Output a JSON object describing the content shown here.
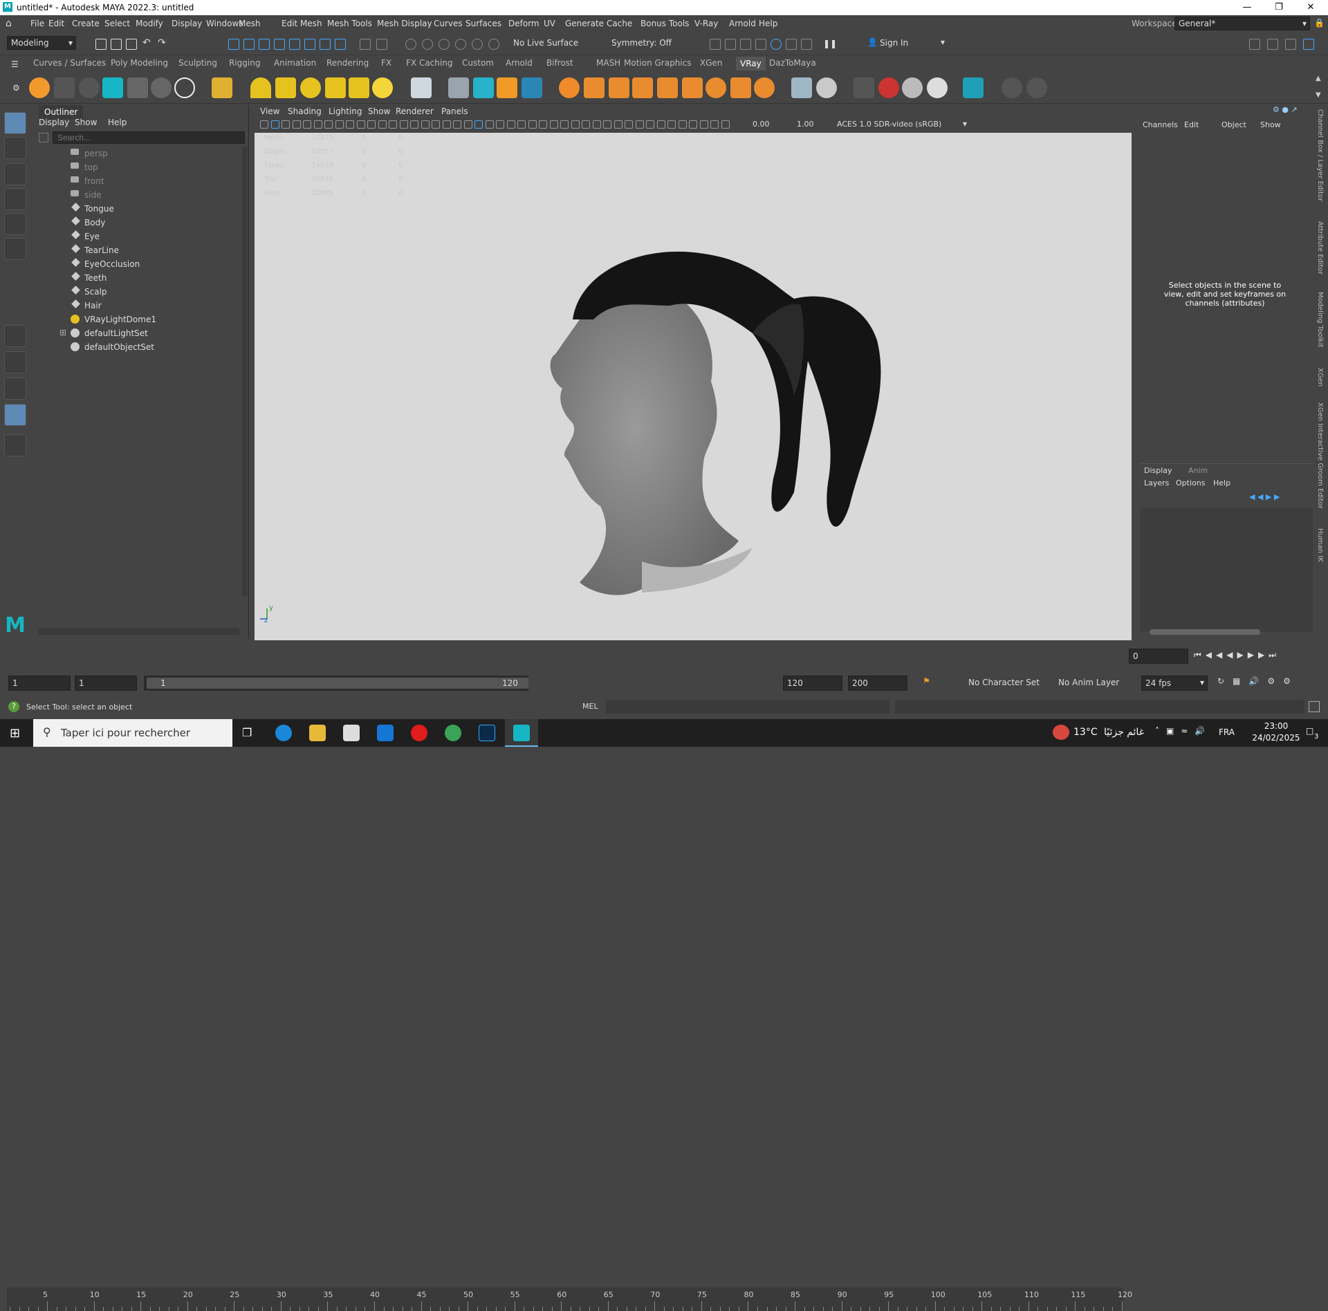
{
  "window": {
    "title": "untitled* - Autodesk MAYA 2022.3: untitled"
  },
  "menus": [
    "File",
    "Edit",
    "Create",
    "Select",
    "Modify",
    "Display",
    "Windows",
    "Mesh",
    "Edit Mesh",
    "Mesh Tools",
    "Mesh Display",
    "Curves",
    "Surfaces",
    "Deform",
    "UV",
    "Generate",
    "Cache",
    "Bonus Tools",
    "V-Ray",
    "Arnold",
    "Help"
  ],
  "workspace": {
    "label": "Workspace:",
    "value": "General*"
  },
  "status": {
    "mode": "Modeling",
    "live_surface": "No Live Surface",
    "symmetry": "Symmetry: Off",
    "sign_in": "Sign In"
  },
  "shelf_tabs": [
    "Curves / Surfaces",
    "Poly Modeling",
    "Sculpting",
    "Rigging",
    "Animation",
    "Rendering",
    "FX",
    "FX Caching",
    "Custom",
    "Arnold",
    "Bifrost",
    "MASH",
    "Motion Graphics",
    "XGen",
    "VRay",
    "DazToMaya"
  ],
  "active_shelf": "VRay",
  "outliner": {
    "title": "Outliner",
    "menu": [
      "Display",
      "Show",
      "Help"
    ],
    "search_placeholder": "Search...",
    "items": [
      {
        "name": "persp",
        "icon": "camera-icon",
        "dim": true
      },
      {
        "name": "top",
        "icon": "camera-icon",
        "dim": true
      },
      {
        "name": "front",
        "icon": "camera-icon",
        "dim": true
      },
      {
        "name": "side",
        "icon": "camera-icon",
        "dim": true
      },
      {
        "name": "Tongue",
        "icon": "mesh-icon"
      },
      {
        "name": "Body",
        "icon": "mesh-icon"
      },
      {
        "name": "Eye",
        "icon": "mesh-icon"
      },
      {
        "name": "TearLine",
        "icon": "mesh-icon"
      },
      {
        "name": "EyeOcclusion",
        "icon": "mesh-icon"
      },
      {
        "name": "Teeth",
        "icon": "mesh-icon"
      },
      {
        "name": "Scalp",
        "icon": "mesh-icon"
      },
      {
        "name": "Hair",
        "icon": "mesh-icon"
      },
      {
        "name": "VRayLightDome1",
        "icon": "dome-light-icon"
      },
      {
        "name": "defaultLightSet",
        "icon": "set-icon",
        "expandable": true
      },
      {
        "name": "defaultObjectSet",
        "icon": "set-icon"
      }
    ]
  },
  "viewport": {
    "menu": [
      "View",
      "Shading",
      "Lighting",
      "Show",
      "Renderer",
      "Panels"
    ],
    "exposure": "0.00",
    "gamma": "1.00",
    "color_space": "ACES 1.0 SDR-video (sRGB)",
    "hud": [
      {
        "label": "Verts:",
        "a": "27873",
        "b": "0",
        "c": "0"
      },
      {
        "label": "Edges:",
        "a": "52557",
        "b": "0",
        "c": "0"
      },
      {
        "label": "Faces:",
        "a": "24834",
        "b": "0",
        "c": "0"
      },
      {
        "label": "Tris:",
        "a": "38536",
        "b": "0",
        "c": "0"
      },
      {
        "label": "UVs:",
        "a": "28895",
        "b": "0",
        "c": "0"
      }
    ]
  },
  "channel_box": {
    "menu": [
      "Channels",
      "Edit",
      "Object",
      "Show"
    ],
    "message": "Select objects in the scene to view, edit and set keyframes on channels (attributes)",
    "layer_tabs": [
      "Display",
      "Anim"
    ],
    "layer_menu": [
      "Layers",
      "Options",
      "Help"
    ]
  },
  "right_strip": [
    "Channel Box / Layer Editor",
    "Attribute Editor",
    "Modeling Toolkit",
    "XGen",
    "XGen Interactive Groom Editor",
    "Human IK"
  ],
  "timeline": {
    "ticks": [
      "5",
      "10",
      "15",
      "20",
      "25",
      "30",
      "35",
      "40",
      "45",
      "50",
      "55",
      "60",
      "65",
      "70",
      "75",
      "80",
      "85",
      "90",
      "95",
      "100",
      "105",
      "110",
      "115",
      "120"
    ],
    "current_frame": "0"
  },
  "range": {
    "start": "1",
    "playback_start": "1",
    "slider_start": "1",
    "slider_end": "120",
    "playback_end": "120",
    "end": "200",
    "character_set": "No Character Set",
    "anim_layer": "No Anim Layer",
    "fps": "24 fps"
  },
  "command": {
    "help": "Select Tool: select an object",
    "lang": "MEL"
  },
  "taskbar": {
    "search": "Taper ici pour rechercher",
    "weather": "13°C",
    "weather_text": "غائم جزئيًا",
    "lang": "FRA",
    "time": "23:00",
    "date": "24/02/2025",
    "notif": "3"
  }
}
